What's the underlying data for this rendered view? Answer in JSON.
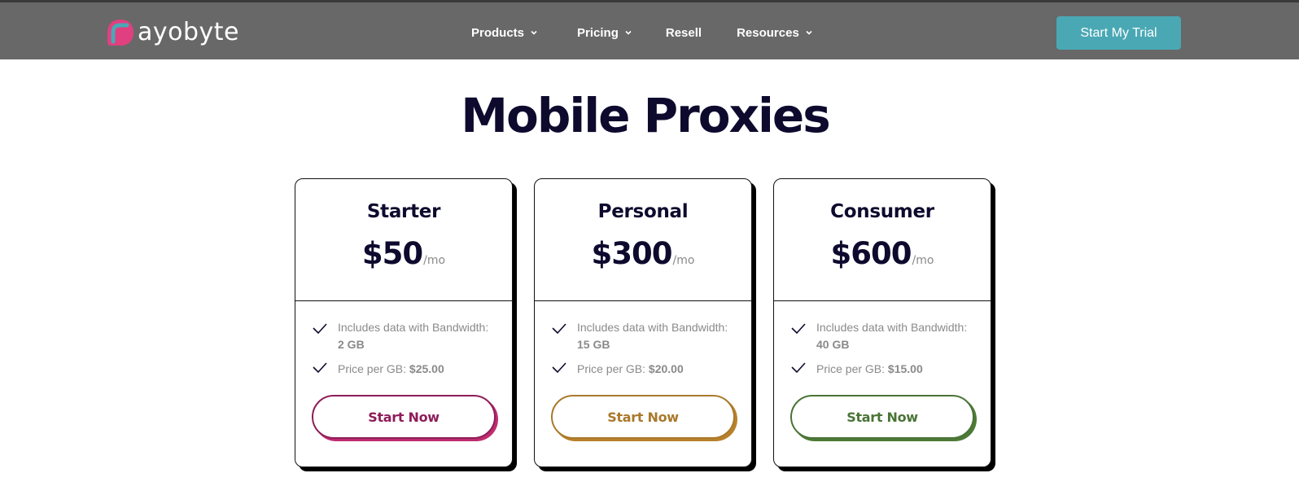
{
  "header": {
    "logo_text": "ayobyte",
    "nav": [
      {
        "label": "Products",
        "has_dropdown": true
      },
      {
        "label": "Pricing",
        "has_dropdown": true
      },
      {
        "label": "Resell",
        "has_dropdown": false
      },
      {
        "label": "Resources",
        "has_dropdown": true
      }
    ],
    "cta_label": "Start My Trial"
  },
  "main": {
    "title": "Mobile Proxies",
    "plans": [
      {
        "name": "Starter",
        "price": "$50",
        "period": "/mo",
        "bandwidth_label": "Includes data with Bandwidth: ",
        "bandwidth_value": "2 GB",
        "price_per_gb_label": "Price per GB: ",
        "price_per_gb_value": "$25.00",
        "button_label": "Start Now",
        "accent_color": "#8e1d59",
        "shadow_color": "#c02b6f"
      },
      {
        "name": "Personal",
        "price": "$300",
        "period": "/mo",
        "bandwidth_label": "Includes data with Bandwidth: ",
        "bandwidth_value": "15 GB",
        "price_per_gb_label": "Price per GB: ",
        "price_per_gb_value": "$20.00",
        "button_label": "Start Now",
        "accent_color": "#a9792b",
        "shadow_color": "#b9812b"
      },
      {
        "name": "Consumer",
        "price": "$600",
        "period": "/mo",
        "bandwidth_label": "Includes data with Bandwidth: ",
        "bandwidth_value": "40 GB",
        "price_per_gb_label": "Price per GB: ",
        "price_per_gb_value": "$15.00",
        "button_label": "Start Now",
        "accent_color": "#4a7436",
        "shadow_color": "#4e7a37"
      }
    ]
  },
  "colors": {
    "navbar_bg": "#686868",
    "cta_bg": "#4aa8b5",
    "title_color": "#0e0a2e",
    "logo_pink": "#e0407f",
    "logo_teal": "#4aa8b5"
  }
}
